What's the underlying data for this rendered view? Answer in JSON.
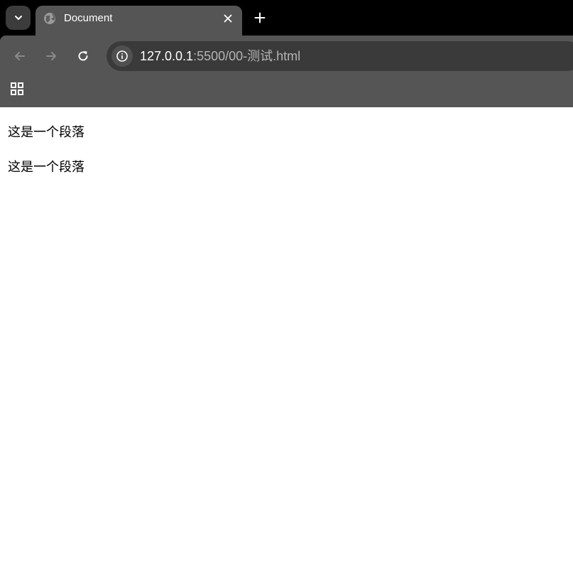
{
  "browser": {
    "tab": {
      "title": "Document",
      "favicon": "globe-icon"
    },
    "tab_search_icon": "chevron-down-icon",
    "new_tab_icon": "plus-icon",
    "nav": {
      "back_icon": "arrow-left-icon",
      "forward_icon": "arrow-right-icon",
      "reload_icon": "reload-icon"
    },
    "address_bar": {
      "host": "127.0.0.1",
      "path": ":5500/00-测试.html",
      "site_info_icon": "info-icon"
    },
    "apps_icon": "apps-grid-icon"
  },
  "content": {
    "paragraphs": [
      "这是一个段落",
      "这是一个段落"
    ]
  },
  "colors": {
    "tab_strip": "#000000",
    "toolbar": "#555555",
    "omnibox": "#3a3a3a",
    "page": "#ffffff"
  }
}
